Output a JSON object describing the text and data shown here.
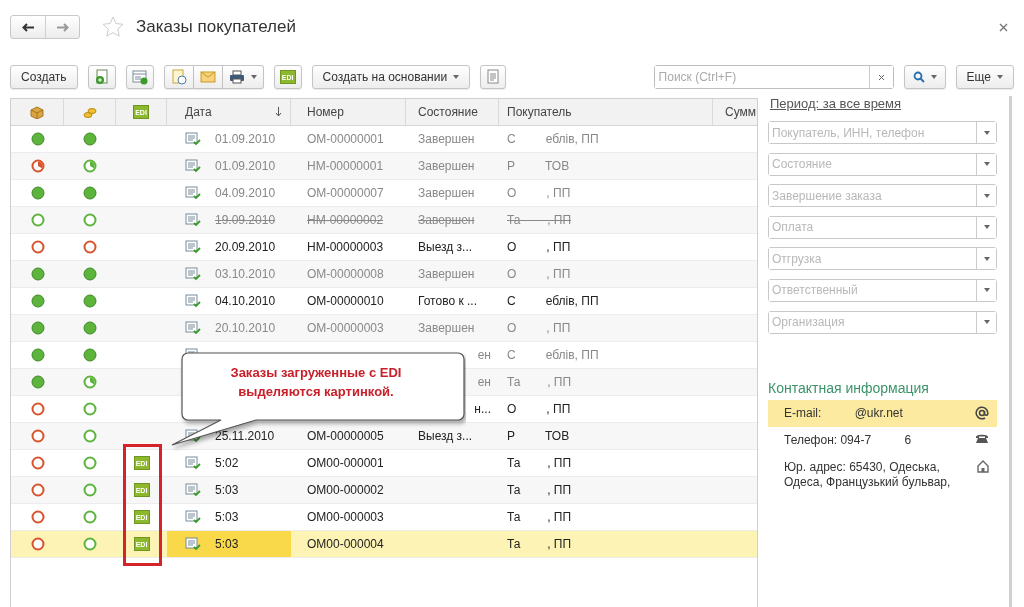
{
  "window": {
    "title": "Заказы покупателей"
  },
  "toolbar": {
    "create": "Создать",
    "edi": "EDI",
    "create_based": "Создать на основании",
    "search": {
      "placeholder": "Поиск (Ctrl+F)"
    },
    "more": "Еще"
  },
  "table": {
    "columns": [
      "EDI",
      "Дата",
      "Номер",
      "Состояние",
      "Покупатель",
      "Сумм"
    ],
    "rows": [
      {
        "shipment": {
          "kind": "full",
          "color": "#5cb43c"
        },
        "payment": {
          "kind": "full",
          "color": "#5cb43c"
        },
        "completed": true,
        "deleted": false,
        "date": "01.09.2010",
        "number": "ОМ-00000001",
        "state": "Завершен",
        "buyer": "С         еблів, ПП",
        "selected": false
      },
      {
        "shipment": {
          "kind": "partial",
          "color": "#d9532c"
        },
        "payment": {
          "kind": "partial",
          "color": "#5cb43c"
        },
        "completed": true,
        "deleted": false,
        "date": "01.09.2010",
        "number": "НМ-00000001",
        "state": "Завершен",
        "buyer": "Р         ТОВ",
        "selected": false
      },
      {
        "shipment": {
          "kind": "full",
          "color": "#5cb43c"
        },
        "payment": {
          "kind": "full",
          "color": "#5cb43c"
        },
        "completed": true,
        "deleted": false,
        "date": "04.09.2010",
        "number": "ОМ-00000007",
        "state": "Завершен",
        "buyer": "О         , ПП",
        "selected": false
      },
      {
        "shipment": {
          "kind": "empty",
          "color": "#5cb43c"
        },
        "payment": {
          "kind": "empty",
          "color": "#5cb43c"
        },
        "completed": true,
        "deleted": true,
        "date": "19.09.2010",
        "number": "НМ-00000002",
        "state": "Завершен",
        "buyer": "Та        , ПП",
        "selected": false
      },
      {
        "shipment": {
          "kind": "empty",
          "color": "#d9532c"
        },
        "payment": {
          "kind": "empty",
          "color": "#d9532c"
        },
        "completed": false,
        "deleted": false,
        "date": "20.09.2010",
        "number": "НМ-00000003",
        "state": "Выезд з...",
        "buyer": "О         , ПП",
        "selected": false
      },
      {
        "shipment": {
          "kind": "full",
          "color": "#5cb43c"
        },
        "payment": {
          "kind": "full",
          "color": "#5cb43c"
        },
        "completed": true,
        "deleted": false,
        "date": "03.10.2010",
        "number": "ОМ-00000008",
        "state": "Завершен",
        "buyer": "О         , ПП",
        "selected": false
      },
      {
        "shipment": {
          "kind": "full",
          "color": "#5cb43c"
        },
        "payment": {
          "kind": "full",
          "color": "#5cb43c"
        },
        "completed": false,
        "deleted": false,
        "date": "04.10.2010",
        "number": "ОМ-00000010",
        "state": "Готово к ...",
        "buyer": "С         еблів, ПП",
        "selected": false
      },
      {
        "shipment": {
          "kind": "full",
          "color": "#5cb43c"
        },
        "payment": {
          "kind": "full",
          "color": "#5cb43c"
        },
        "completed": true,
        "deleted": false,
        "date": "20.10.2010",
        "number": "ОМ-00000003",
        "state": "Завершен",
        "buyer": "О         , ПП",
        "selected": false
      },
      {
        "shipment": {
          "kind": "full",
          "color": "#5cb43c"
        },
        "payment": {
          "kind": "full",
          "color": "#5cb43c"
        },
        "completed": true,
        "deleted": false,
        "state": "ен",
        "buyer": "С         еблів, ПП"
      },
      {
        "shipment": {
          "kind": "full",
          "color": "#5cb43c"
        },
        "payment": {
          "kind": "partial",
          "color": "#5cb43c"
        },
        "completed": true,
        "deleted": false,
        "state": "ен",
        "buyer": "Та        , ПП"
      },
      {
        "shipment": {
          "kind": "empty",
          "color": "#d9532c"
        },
        "payment": {
          "kind": "empty",
          "color": "#5cb43c"
        },
        "completed": false,
        "deleted": false,
        "state": "н...",
        "buyer": "О         , ПП"
      },
      {
        "shipment": {
          "kind": "empty",
          "color": "#d9532c"
        },
        "payment": {
          "kind": "empty",
          "color": "#5cb43c"
        },
        "completed": false,
        "deleted": false,
        "date": "25.11.2010",
        "number": "ОМ-00000005",
        "state": "Выезд з...",
        "buyer": "Р         ТОВ",
        "selected": false
      },
      {
        "shipment": {
          "kind": "empty",
          "color": "#d9532c"
        },
        "payment": {
          "kind": "empty",
          "color": "#5cb43c"
        },
        "completed": false,
        "deleted": false,
        "edi": "EDI",
        "date": "5:02",
        "number": "ОМ00-000001",
        "buyer": "Та        , ПП",
        "selected": false
      },
      {
        "shipment": {
          "kind": "empty",
          "color": "#d9532c"
        },
        "payment": {
          "kind": "empty",
          "color": "#5cb43c"
        },
        "completed": false,
        "deleted": false,
        "edi": "EDI",
        "date": "5:03",
        "number": "ОМ00-000002",
        "buyer": "Та        , ПП",
        "selected": false
      },
      {
        "shipment": {
          "kind": "empty",
          "color": "#d9532c"
        },
        "payment": {
          "kind": "empty",
          "color": "#5cb43c"
        },
        "completed": false,
        "deleted": false,
        "edi": "EDI",
        "date": "5:03",
        "number": "ОМ00-000003",
        "buyer": "Та        , ПП",
        "selected": false
      },
      {
        "shipment": {
          "kind": "empty",
          "color": "#d9532c"
        },
        "payment": {
          "kind": "empty",
          "color": "#5cb43c"
        },
        "completed": false,
        "deleted": false,
        "edi": "EDI",
        "date": "5:03",
        "number": "ОМ00-000004",
        "buyer": "Та        , ПП",
        "selected": true
      }
    ]
  },
  "callout": {
    "text": "Заказы загруженные с EDI выделяются картинкой."
  },
  "filters": {
    "period": "Период: за все время",
    "fields": [
      {
        "placeholder": "Покупатель, ИНН, телефон"
      },
      {
        "placeholder": "Состояние"
      },
      {
        "placeholder": "Завершение заказа"
      },
      {
        "placeholder": "Оплата"
      },
      {
        "placeholder": "Отгрузка"
      },
      {
        "placeholder": "Ответственный"
      },
      {
        "placeholder": "Организация"
      }
    ]
  },
  "contacts": {
    "title": "Контактная информация",
    "items": [
      {
        "kind": "email",
        "text": "E-mail:          @ukr.net",
        "selected": true
      },
      {
        "kind": "phone",
        "text": "Телефон: 094-7          6",
        "selected": false
      },
      {
        "kind": "address",
        "text": "Юр. адрес: 65430, Одеська, Одеса, Французький бульвар,",
        "selected": false
      }
    ]
  }
}
